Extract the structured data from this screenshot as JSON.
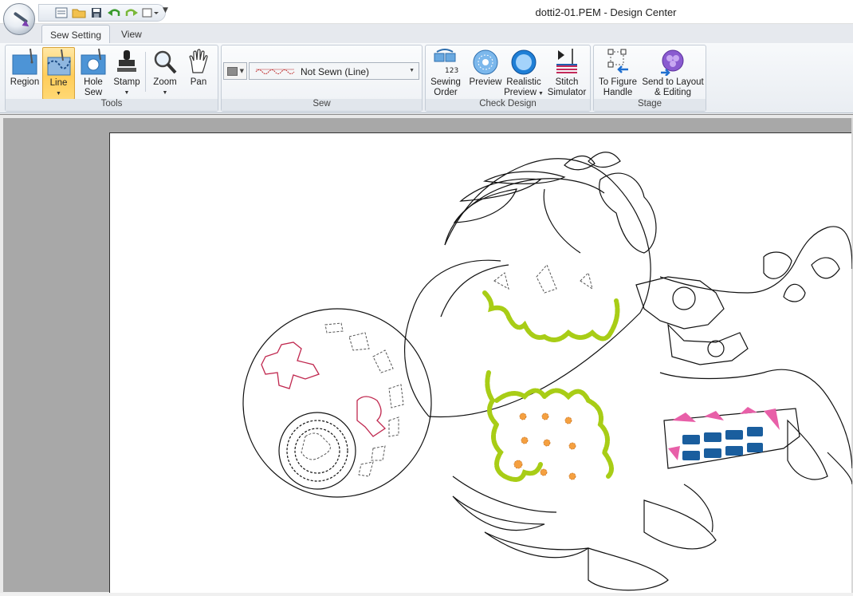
{
  "window": {
    "title": "dotti2-01.PEM - Design Center"
  },
  "quick_access": {
    "icons": [
      "properties-icon",
      "open-icon",
      "save-icon",
      "undo-icon",
      "redo-icon",
      "frame-icon"
    ]
  },
  "tabs": [
    {
      "label": "Sew Setting",
      "active": true
    },
    {
      "label": "View",
      "active": false
    }
  ],
  "ribbon": {
    "groups": {
      "tools": "Tools",
      "sew": "Sew",
      "check_design": "Check Design",
      "stage": "Stage"
    },
    "tools": {
      "region": {
        "line1": "Region",
        "line2": ""
      },
      "line": {
        "line1": "Line",
        "line2": ""
      },
      "hole_sew": {
        "line1": "Hole",
        "line2": "Sew"
      },
      "stamp": {
        "line1": "Stamp",
        "line2": ""
      },
      "zoom": {
        "line1": "Zoom",
        "line2": ""
      },
      "pan": {
        "line1": "Pan",
        "line2": ""
      }
    },
    "sew": {
      "stitch_type": "Not Sewn (Line)",
      "color": "#8c8c8c"
    },
    "check_design": {
      "sewing_order": {
        "line1": "Sewing",
        "line2": "Order",
        "badge": "123"
      },
      "preview": {
        "line1": "Preview",
        "line2": ""
      },
      "realistic_preview": {
        "line1": "Realistic",
        "line2": "Preview"
      },
      "stitch_simulator": {
        "line1": "Stitch",
        "line2": "Simulator"
      }
    },
    "stage": {
      "to_figure_handle": {
        "line1": "To Figure",
        "line2": "Handle"
      },
      "send_to_layout": {
        "line1": "Send to Layout",
        "line2": "& Editing"
      }
    }
  },
  "design_colors": {
    "outline": "#111111",
    "lime_stitch": "#a8cd16",
    "orange_dots": "#f5a040",
    "pink_fill": "#e85fa8",
    "blue_fill": "#1a5e9e",
    "red_line": "#c0284f"
  }
}
